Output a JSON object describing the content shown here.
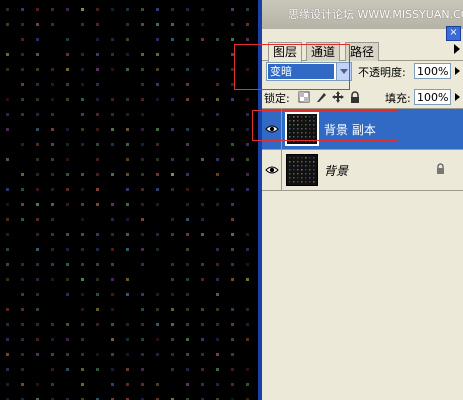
{
  "watermark": "思缘设计论坛 WWW.MISSYUAN.COM",
  "panel": {
    "close_label": "×",
    "tabs": [
      {
        "label": "图层",
        "active": true
      },
      {
        "label": "通道",
        "active": false
      },
      {
        "label": "路径",
        "active": false
      }
    ],
    "blend_mode": {
      "value": "变暗"
    },
    "opacity": {
      "label": "不透明度:",
      "value": "100%"
    },
    "lock": {
      "label": "锁定:"
    },
    "fill": {
      "label": "填充:",
      "value": "100%"
    },
    "layers": [
      {
        "name": "背景 副本",
        "selected": true,
        "visible": true,
        "locked": false
      },
      {
        "name": "背景",
        "selected": false,
        "visible": true,
        "locked": true
      }
    ]
  },
  "colors": {
    "panel_bg": "#ece9d8",
    "selection": "#316ac5",
    "highlight_box": "#e03030",
    "canvas_bg": "#000000"
  }
}
